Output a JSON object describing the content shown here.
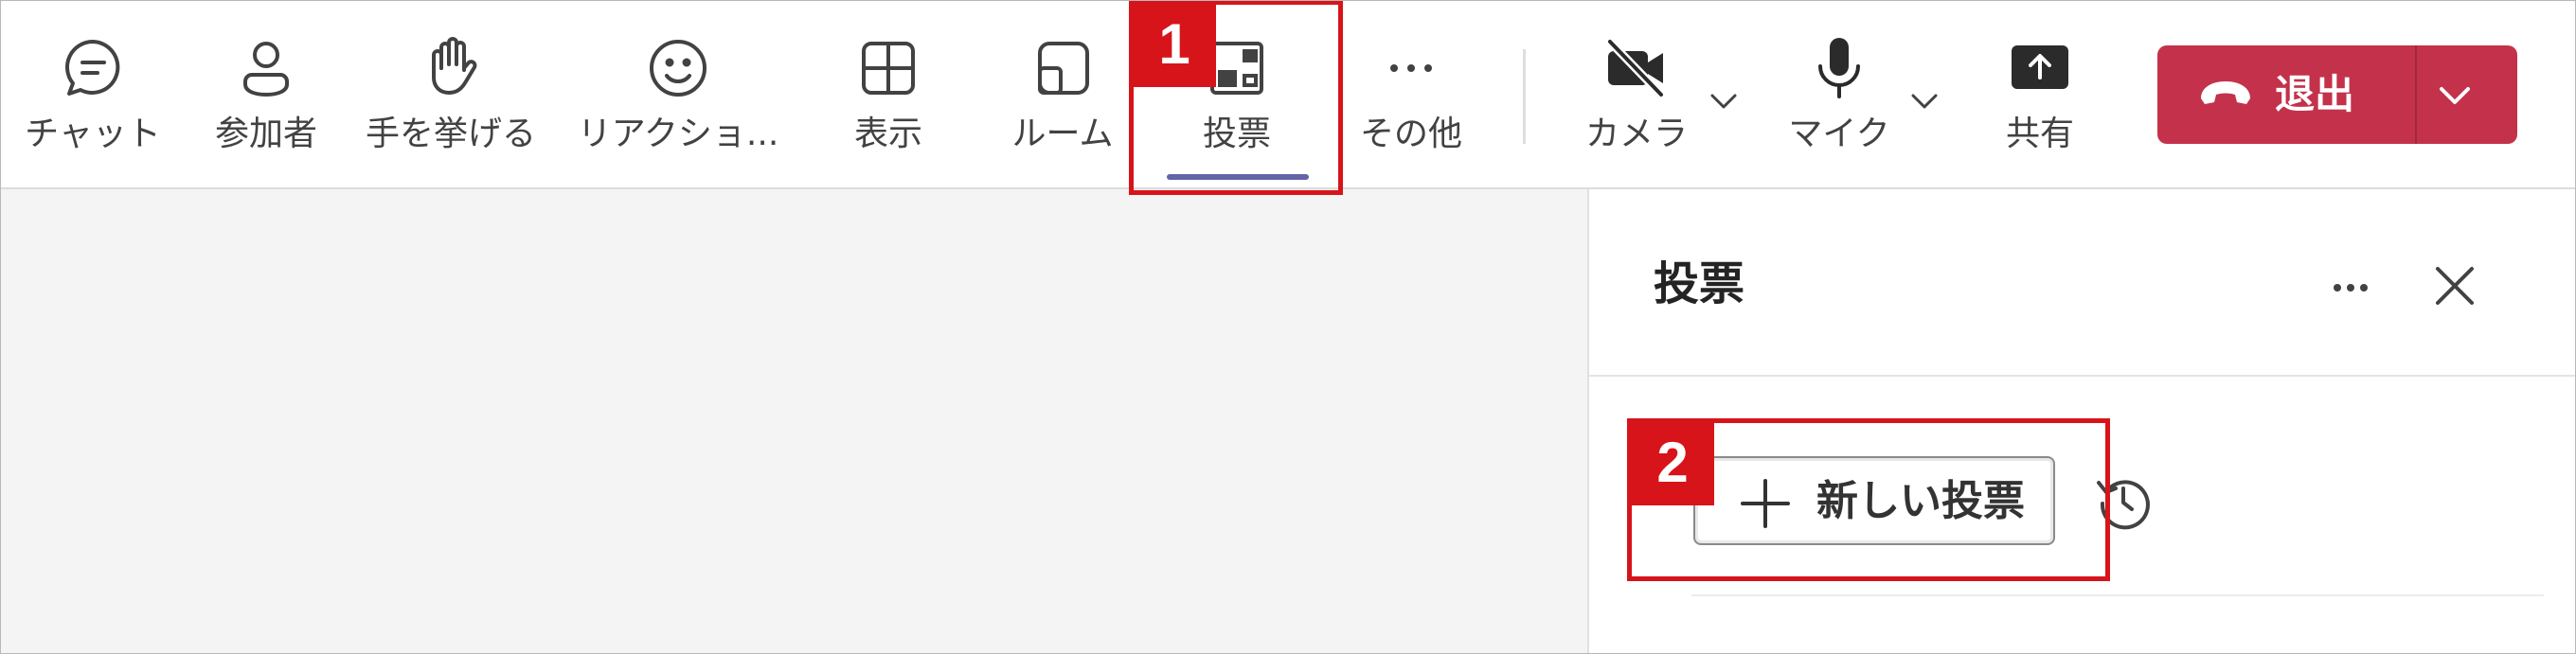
{
  "toolbar": {
    "items": [
      {
        "label": "チャット",
        "icon": "chat-icon"
      },
      {
        "label": "参加者",
        "icon": "people-icon"
      },
      {
        "label": "手を挙げる",
        "icon": "raise-hand-icon"
      },
      {
        "label": "リアクショ...",
        "icon": "reaction-icon"
      },
      {
        "label": "表示",
        "icon": "view-grid-icon"
      },
      {
        "label": "ルーム",
        "icon": "rooms-icon"
      },
      {
        "label": "投票",
        "icon": "polls-icon",
        "active": true
      },
      {
        "label": "その他",
        "icon": "more-icon"
      },
      {
        "label": "カメラ",
        "icon": "camera-off-icon",
        "state": "off"
      },
      {
        "label": "マイク",
        "icon": "microphone-icon",
        "state": "on"
      },
      {
        "label": "共有",
        "icon": "share-screen-icon"
      }
    ],
    "leave_label": "退出"
  },
  "panel": {
    "title": "投票",
    "new_poll_label": "新しい投票"
  },
  "annotations": [
    {
      "number": "1"
    },
    {
      "number": "2"
    }
  ],
  "colors": {
    "accent": "#6264a7",
    "leave": "#c4314b",
    "annotation": "#d7141a"
  }
}
